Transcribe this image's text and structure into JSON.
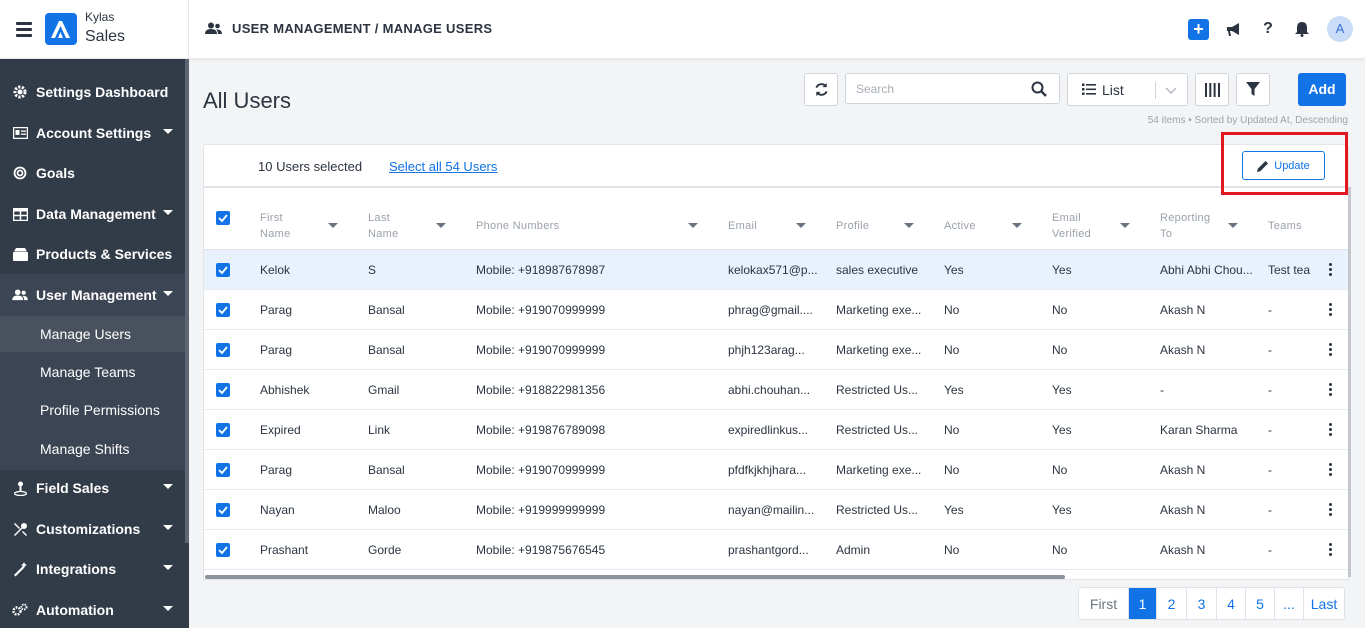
{
  "app": {
    "brand_top": "Kylas",
    "brand_bottom": "Sales"
  },
  "header": {
    "breadcrumb": "USER MANAGEMENT / MANAGE USERS",
    "avatar_initial": "A"
  },
  "sidebar": {
    "items": [
      {
        "label": "Settings Dashboard",
        "icon": "gear-icon"
      },
      {
        "label": "Account Settings",
        "icon": "id-card-icon"
      },
      {
        "label": "Goals",
        "icon": "target-icon"
      },
      {
        "label": "Data Management",
        "icon": "table-icon"
      },
      {
        "label": "Products & Services",
        "icon": "box-icon"
      },
      {
        "label": "User Management",
        "icon": "users-icon"
      },
      {
        "label": "Field Sales",
        "icon": "map-pin-icon"
      },
      {
        "label": "Customizations",
        "icon": "tools-icon"
      },
      {
        "label": "Integrations",
        "icon": "magic-icon"
      },
      {
        "label": "Automation",
        "icon": "cogs-icon"
      }
    ],
    "sub_items": [
      "Manage Users",
      "Manage Teams",
      "Profile Permissions",
      "Manage Shifts"
    ],
    "active_sub": "Manage Users"
  },
  "main": {
    "title": "All Users",
    "search_placeholder": "Search",
    "view_label": "List",
    "add_label": "Add",
    "meta": "54 items • Sorted by Updated At, Descending",
    "selected_text": "10 Users selected",
    "select_all_text": "Select all 54 Users",
    "update_label": "Update"
  },
  "table": {
    "columns": [
      {
        "label": "First\nName"
      },
      {
        "label": "Last\nName"
      },
      {
        "label": "Phone Numbers"
      },
      {
        "label": "Email"
      },
      {
        "label": "Profile"
      },
      {
        "label": "Active"
      },
      {
        "label": "Email\nVerified"
      },
      {
        "label": "Reporting\nTo"
      },
      {
        "label": "Teams"
      }
    ],
    "rows": [
      [
        "Kelok",
        "S",
        "Mobile: +918987678987",
        "kelokax571@p...",
        "sales executive",
        "Yes",
        "Yes",
        "Abhi Abhi Chou...",
        "Test tea"
      ],
      [
        "Parag",
        "Bansal",
        "Mobile: +919070999999",
        "phrag@gmail....",
        "Marketing exe...",
        "No",
        "No",
        "Akash N",
        "-"
      ],
      [
        "Parag",
        "Bansal",
        "Mobile: +919070999999",
        "phjh123arag...",
        "Marketing exe...",
        "No",
        "No",
        "Akash N",
        "-"
      ],
      [
        "Abhishek",
        "Gmail",
        "Mobile: +918822981356",
        "abhi.chouhan...",
        "Restricted Us...",
        "Yes",
        "Yes",
        "-",
        "-"
      ],
      [
        "Expired",
        "Link",
        "Mobile: +919876789098",
        "expiredlinkus...",
        "Restricted Us...",
        "No",
        "Yes",
        "Karan Sharma",
        "-"
      ],
      [
        "Parag",
        "Bansal",
        "Mobile: +919070999999",
        "pfdfkjkhjhara...",
        "Marketing exe...",
        "No",
        "No",
        "Akash N",
        "-"
      ],
      [
        "Nayan",
        "Maloo",
        "Mobile: +919999999999",
        "nayan@mailin...",
        "Restricted Us...",
        "Yes",
        "Yes",
        "Akash N",
        "-"
      ],
      [
        "Prashant",
        "Gorde",
        "Mobile: +919875676545",
        "prashantgord...",
        "Admin",
        "No",
        "No",
        "Akash N",
        "-"
      ]
    ]
  },
  "pagination": {
    "pages": [
      "First",
      "1",
      "2",
      "3",
      "4",
      "5",
      "...",
      "Last"
    ],
    "current": "1"
  },
  "colors": {
    "accent": "#1173e6",
    "sidebar": "#323b48",
    "highlight": "#e3191f"
  }
}
